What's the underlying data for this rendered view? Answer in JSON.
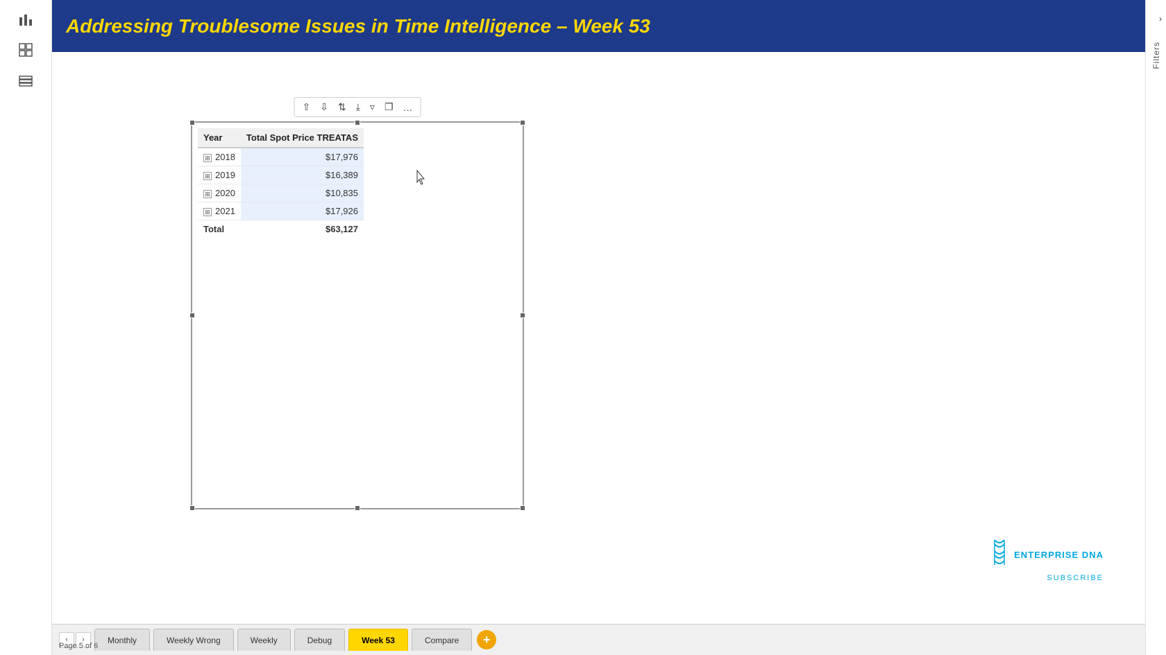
{
  "header": {
    "title": "Addressing Troublesome Issues in Time Intelligence – Week 53"
  },
  "sidebar": {
    "icons": [
      "bar-chart",
      "grid",
      "layers"
    ]
  },
  "toolbar": {
    "icons": [
      "sort-asc",
      "sort-desc",
      "sort-both",
      "download",
      "filter",
      "expand",
      "more"
    ]
  },
  "table": {
    "columns": [
      "Year",
      "Total Spot Price TREATAS"
    ],
    "rows": [
      {
        "year": "2018",
        "value": "$17,976"
      },
      {
        "year": "2019",
        "value": "$16,389"
      },
      {
        "year": "2020",
        "value": "$10,835"
      },
      {
        "year": "2021",
        "value": "$17,926"
      }
    ],
    "total": {
      "label": "Total",
      "value": "$63,127"
    }
  },
  "tabs": [
    {
      "id": "monthly",
      "label": "Monthly",
      "active": false
    },
    {
      "id": "weekly-wrong",
      "label": "Weekly Wrong",
      "active": false
    },
    {
      "id": "weekly",
      "label": "Weekly",
      "active": false
    },
    {
      "id": "debug",
      "label": "Debug",
      "active": false
    },
    {
      "id": "week-53",
      "label": "Week 53",
      "active": true
    },
    {
      "id": "compare",
      "label": "Compare",
      "active": false
    }
  ],
  "status": {
    "page": "Page 5 of 6"
  },
  "logo": {
    "name": "ENTERPRISE DNA",
    "subscribe": "SUBSCRIBE"
  },
  "filters_label": "Filters"
}
